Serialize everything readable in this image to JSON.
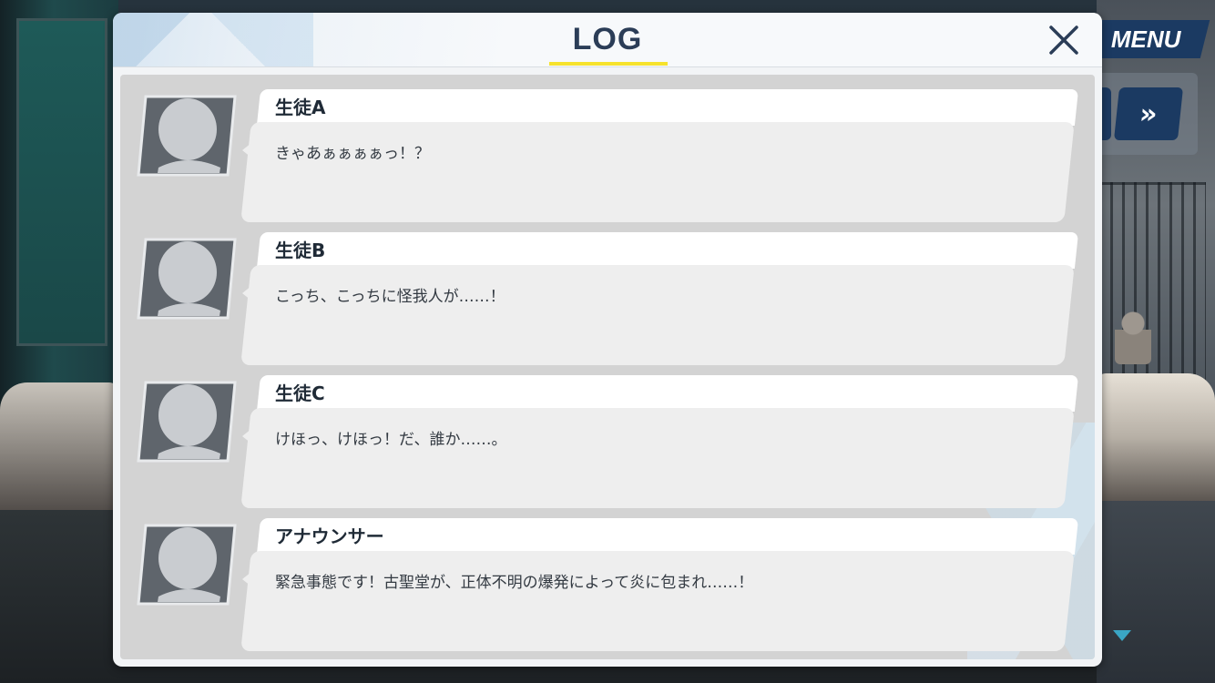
{
  "hud": {
    "menu_label": "MENU",
    "skip_label": "»"
  },
  "dialog": {
    "title": "LOG",
    "entries": [
      {
        "speaker": "生徒A",
        "text": "きゃあぁぁぁぁっ！？"
      },
      {
        "speaker": "生徒B",
        "text": "こっち、こっちに怪我人が……！"
      },
      {
        "speaker": "生徒C",
        "text": "けほっ、けほっ！だ、誰か……。"
      },
      {
        "speaker": "アナウンサー",
        "text": "緊急事態です！古聖堂が、正体不明の爆発によって炎に包まれ……！"
      }
    ]
  },
  "colors": {
    "title": "#2b3d57",
    "underline": "#f6e22c",
    "menu_button": "#1b3a62",
    "next_arrow": "#3aa6c5"
  }
}
